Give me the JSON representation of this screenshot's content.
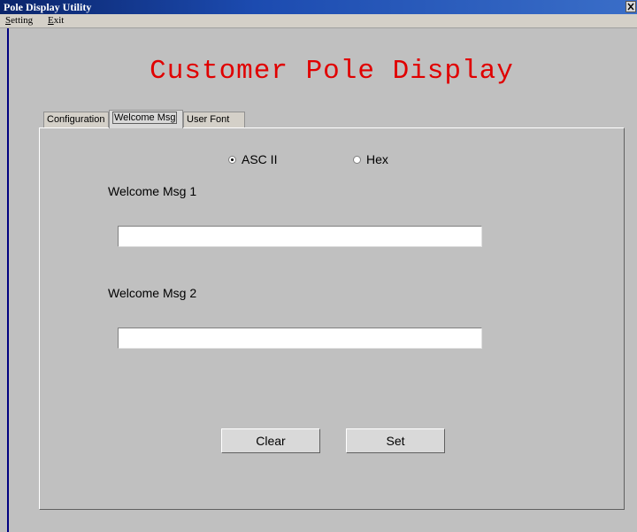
{
  "window": {
    "title": "Pole Display Utility"
  },
  "menu": [
    {
      "mnemonic": "S",
      "rest": "etting"
    },
    {
      "mnemonic": "E",
      "rest": "xit"
    }
  ],
  "app_title": "Customer Pole Display",
  "tabs": [
    {
      "label": "Configuration",
      "active": false
    },
    {
      "label": "Welcome Msg",
      "active": true
    },
    {
      "label": "User Font",
      "active": false
    }
  ],
  "format": {
    "options": [
      {
        "label": "ASC II",
        "selected": true
      },
      {
        "label": "Hex",
        "selected": false
      }
    ]
  },
  "msg1": {
    "label": "Welcome Msg 1",
    "value": ""
  },
  "msg2": {
    "label": "Welcome Msg 2",
    "value": ""
  },
  "buttons": {
    "clear": "Clear",
    "set": "Set"
  },
  "colors": {
    "title_red": "#e00000",
    "titlebar_blue": "#0a246a",
    "face_gray": "#c0c0c0"
  }
}
